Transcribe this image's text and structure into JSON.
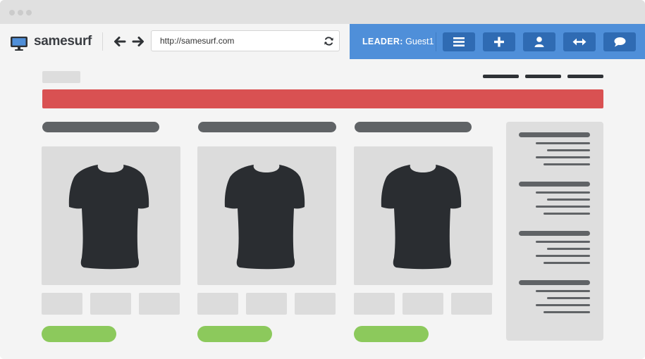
{
  "browser": {
    "brand": "samesurf",
    "url": "http://samesurf.com",
    "icons": [
      "monitor-icon",
      "back-arrow-icon",
      "forward-arrow-icon",
      "refresh-icon"
    ]
  },
  "collab": {
    "leader_label": "LEADER:",
    "leader_name": "Guest1",
    "buttons": [
      "menu-icon",
      "plus-icon",
      "user-icon",
      "swap-arrows-icon",
      "chat-icon"
    ]
  },
  "colors": {
    "collab_bar": "#4f8fd9",
    "collab_button": "#2f6bb3",
    "banner": "#d95152",
    "buy_button": "#8cc95c",
    "shirt": "#2a2d31"
  },
  "products": [
    {
      "icon": "tshirt-icon"
    },
    {
      "icon": "tshirt-icon"
    },
    {
      "icon": "tshirt-icon"
    }
  ]
}
